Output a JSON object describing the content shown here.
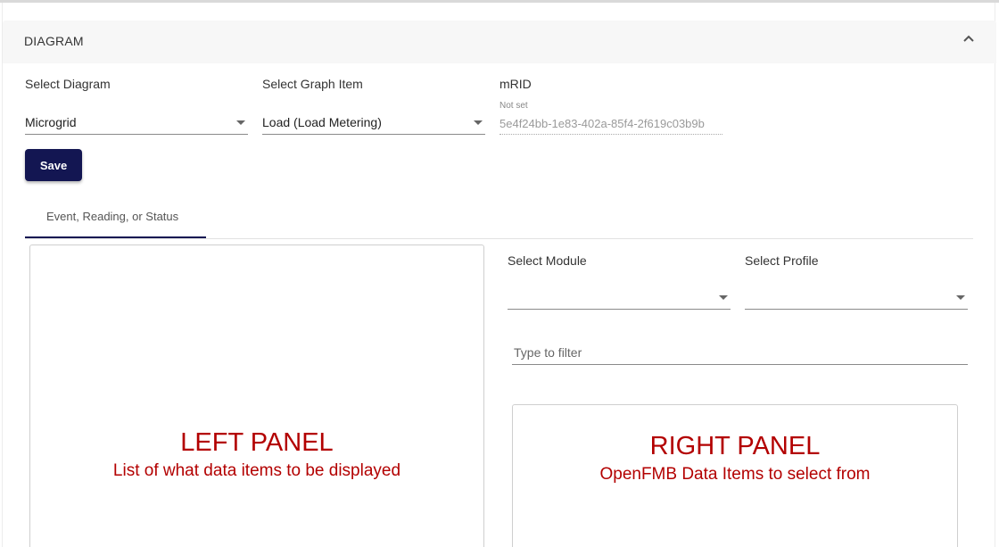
{
  "card": {
    "title": "DIAGRAM",
    "collapse_icon": "chevron-up-icon"
  },
  "fields": {
    "diagram": {
      "label": "Select Diagram",
      "value": "Microgrid"
    },
    "graph_item": {
      "label": "Select Graph Item",
      "value": "Load (Load Metering)"
    },
    "mrid": {
      "label": "mRID",
      "hint": "Not set",
      "value": "5e4f24bb-1e83-402a-85f4-2f619c03b9b"
    }
  },
  "actions": {
    "save_label": "Save"
  },
  "tabs": [
    {
      "label": "Event, Reading, or Status",
      "active": true
    }
  ],
  "module": {
    "label": "Select Module",
    "value": ""
  },
  "profile": {
    "label": "Select Profile",
    "value": ""
  },
  "filter": {
    "placeholder": "Type to filter"
  },
  "left_panel": {
    "title": "LEFT PANEL",
    "subtitle": "List of what data items to be displayed"
  },
  "right_panel": {
    "title": "RIGHT PANEL",
    "subtitle": "OpenFMB Data Items to select from"
  },
  "colors": {
    "primary": "#131652",
    "annotation": "#b30000",
    "header_bg": "#f7f7f7"
  }
}
